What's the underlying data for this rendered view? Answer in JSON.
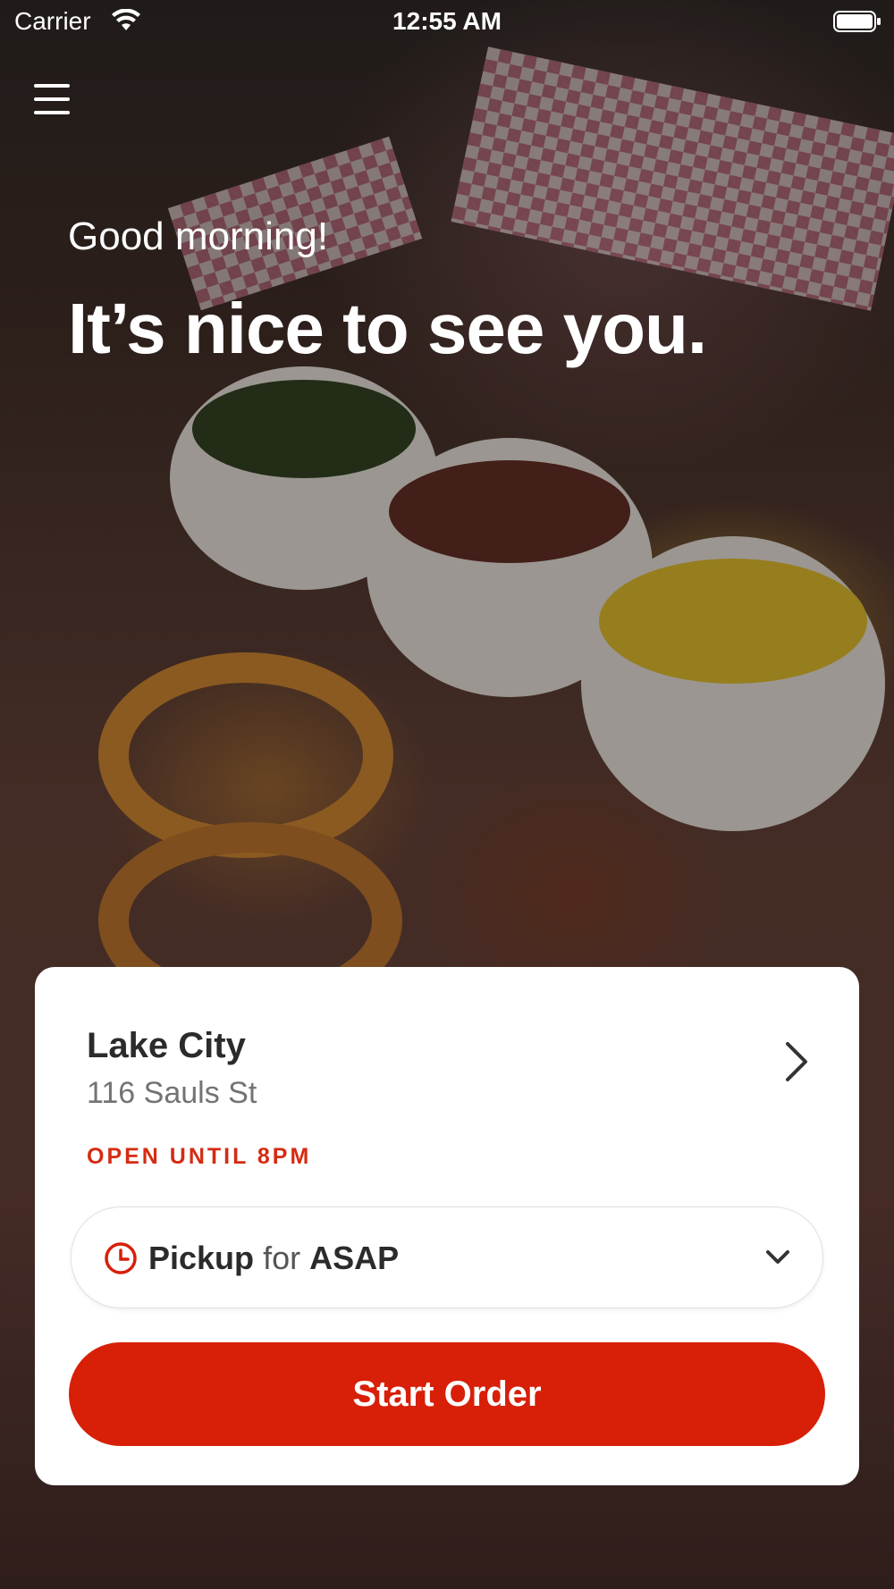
{
  "status_bar": {
    "carrier": "Carrier",
    "time": "12:55 AM"
  },
  "greeting": {
    "small": "Good morning!",
    "large": "It’s nice to see you."
  },
  "location": {
    "name": "Lake City",
    "address": "116 Sauls St",
    "status": "OPEN UNTIL 8PM"
  },
  "pickup": {
    "mode": "Pickup",
    "connector": "for",
    "time": "ASAP"
  },
  "actions": {
    "start_order": "Start Order"
  },
  "colors": {
    "accent": "#d81f08",
    "status_red": "#d52b12",
    "card": "#ffffff"
  }
}
